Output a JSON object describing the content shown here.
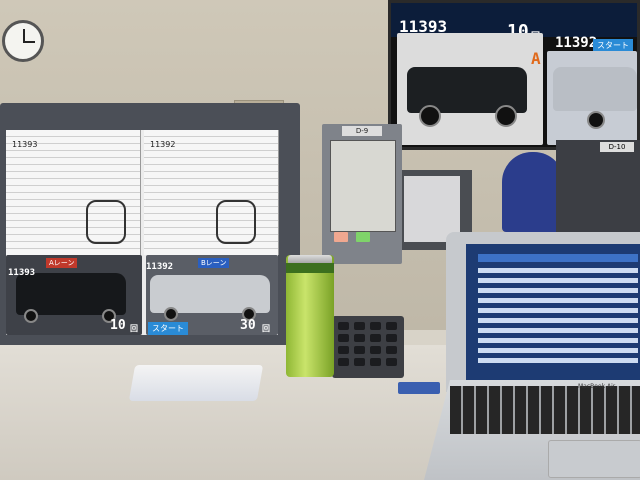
{
  "wall_monitor": {
    "lot_left": "11393",
    "lot_right": "11392",
    "count_left": "10",
    "count_unit": "回",
    "lane_letter": "A",
    "start_label": "スタート"
  },
  "left_monitor": {
    "sheet_left_no": "11393",
    "sheet_right_no": "11392",
    "lane_a": "Aレーン",
    "lane_b": "Bレーン",
    "lot_a": "11393",
    "lot_b": "11392",
    "count_a": "10",
    "count_b": "30",
    "unit": "回",
    "start_label": "スタート"
  },
  "control_box": {
    "label": "D-9"
  },
  "control_box_right": {
    "label": "D-10"
  },
  "laptop": {
    "brand": "MacBook Air"
  },
  "colors": {
    "wall": "#cfc8b8",
    "desk": "#e2ded6",
    "monitor_bezel": "#4b4f57",
    "can_green": "#8fb734",
    "accent_blue": "#2a8bd6",
    "lane_red": "#c0392b"
  }
}
